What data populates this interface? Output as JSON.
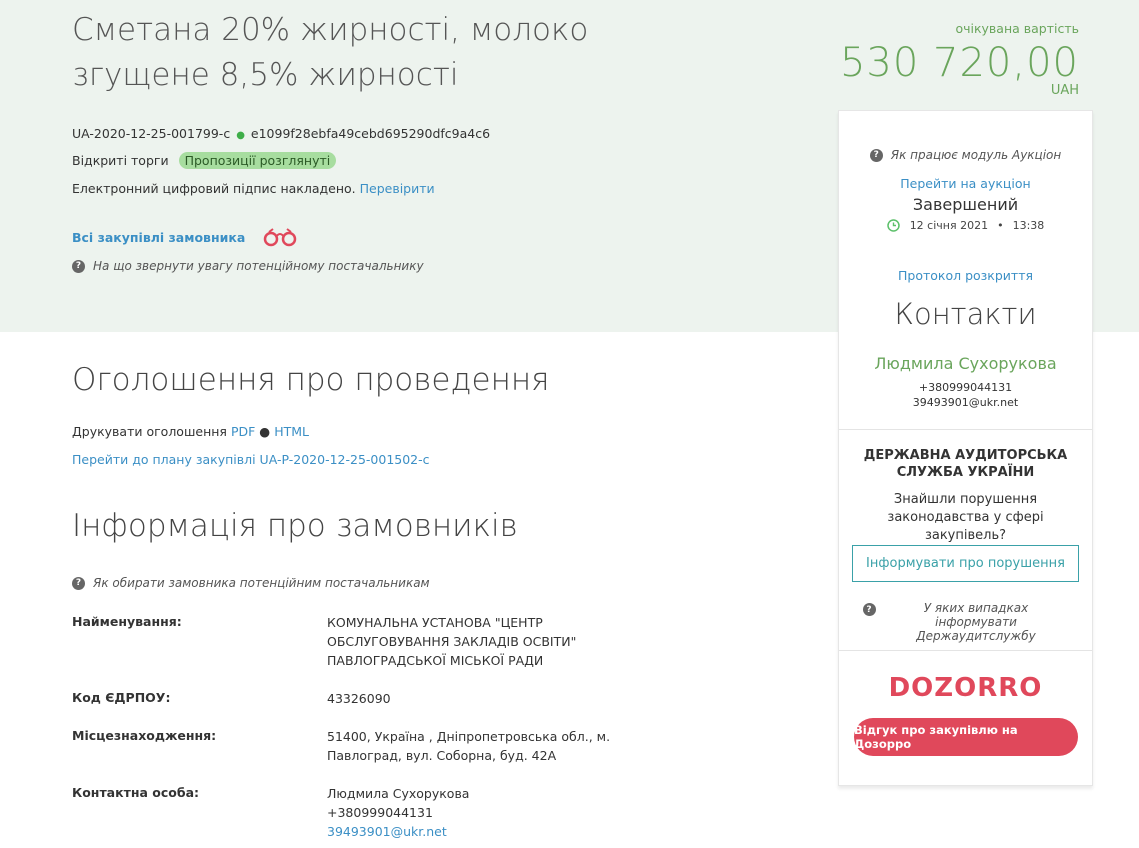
{
  "tender": {
    "title": "Сметана 20% жирності, молоко згущене 8,5% жирності",
    "tender_id": "UA-2020-12-25-001799-c",
    "hash": "e1099f28ebfa49cebd695290dfc9a4c6",
    "type": "Відкриті торги",
    "status_badge": "Пропозиції розглянуті",
    "signature_text": "Електронний цифровий підпис накладено.",
    "verify_link": "Перевірити",
    "all_purchases_link": "Всі закупівлі замовника",
    "attention_help": "На що звернути увагу потенційному постачальнику",
    "price_label": "очікувана вартість",
    "price": "530 720,00",
    "currency": "UAH"
  },
  "sidebar": {
    "auction_help": "Як працює модуль Аукціон",
    "auction_link": "Перейти на аукціон",
    "auction_status": "Завершений",
    "auction_date": "12 січня 2021",
    "auction_time": "13:38",
    "protocol_link": "Протокол розкриття",
    "contacts_title": "Контакти",
    "contact_name": "Людмила Сухорукова",
    "contact_phone": "+380999044131",
    "contact_email": "39493901@ukr.net",
    "audit_title": "ДЕРЖАВНА АУДИТОРСЬКА СЛУЖБА УКРАЇНИ",
    "audit_text": "Знайшли порушення законодавства у сфері закупівель?",
    "report_button": "Інформувати про порушення",
    "audit_help": "У яких випадках інформувати Держаудитслужбу",
    "dozorro_logo": "DOZORRO",
    "dozorro_button": "Відгук про закупівлю на Дозорро"
  },
  "announcement": {
    "title": "Оголошення про проведення",
    "print_label": "Друкувати оголошення",
    "pdf_link": "PDF",
    "html_link": "HTML",
    "plan_link": "Перейти до плану закупівлі UA-P-2020-12-25-001502-c"
  },
  "customer": {
    "title": "Інформація про замовників",
    "help": "Як обирати замовника потенційним постачальникам",
    "name_label": "Найменування:",
    "name_value": "КОМУНАЛЬНА УСТАНОВА \"ЦЕНТР ОБСЛУГОВУВАННЯ ЗАКЛАДІВ ОСВІТИ\" ПАВЛОГРАДСЬКОЇ МІСЬКОЇ РАДИ",
    "edrpou_label": "Код ЄДРПОУ:",
    "edrpou_value": "43326090",
    "location_label": "Місцезнаходження:",
    "location_value": "51400, Україна , Дніпропетровська обл., м. Павлоград, вул. Соборна, буд. 42А",
    "contact_label": "Контактна особа:",
    "contact_name": "Людмила Сухорукова",
    "contact_phone": "+380999044131",
    "contact_email": "39493901@ukr.net"
  },
  "colors": {
    "hero_bg": "#edf3ee",
    "accent_green": "#6aa55c",
    "link_blue": "#3b8fc5",
    "dozorro_red": "#e0485b"
  }
}
